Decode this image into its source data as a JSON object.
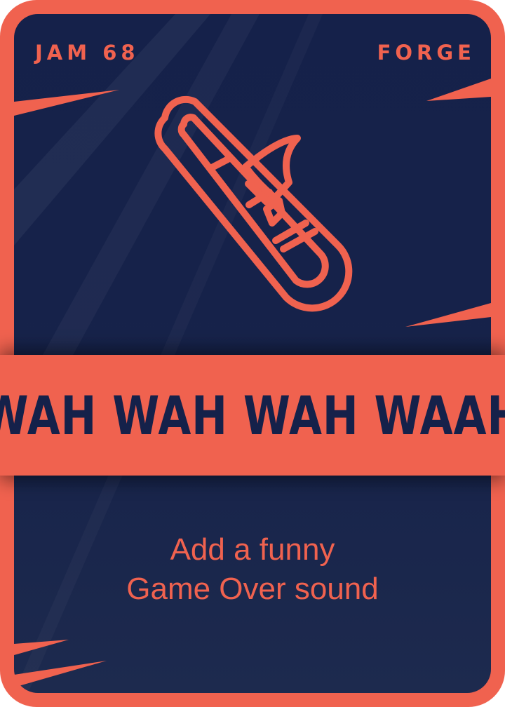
{
  "card": {
    "top_left": "JAM 68",
    "top_right": "FORGE",
    "title": "WAH WAH WAH WAAH",
    "description_line1": "Add a funny",
    "description_line2": "Game Over sound",
    "icon": "trombone-icon"
  },
  "colors": {
    "accent": "#f0624f",
    "background": "#15214a"
  }
}
